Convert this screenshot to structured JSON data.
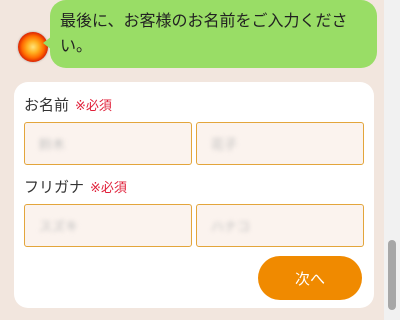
{
  "chat": {
    "message": "最後に、お客様のお名前をご入力ください。"
  },
  "form": {
    "name": {
      "label": "お名前",
      "required": "※必須",
      "last_placeholder": "鈴木",
      "first_placeholder": "花子"
    },
    "furigana": {
      "label": "フリガナ",
      "required": "※必須",
      "last_placeholder": "スズキ",
      "first_placeholder": "ハナコ"
    },
    "next_label": "次へ"
  },
  "colors": {
    "background": "#f2e6de",
    "bubble": "#99dd66",
    "input_border": "#e3a53b",
    "button": "#f08a00",
    "required": "#e0203a"
  }
}
